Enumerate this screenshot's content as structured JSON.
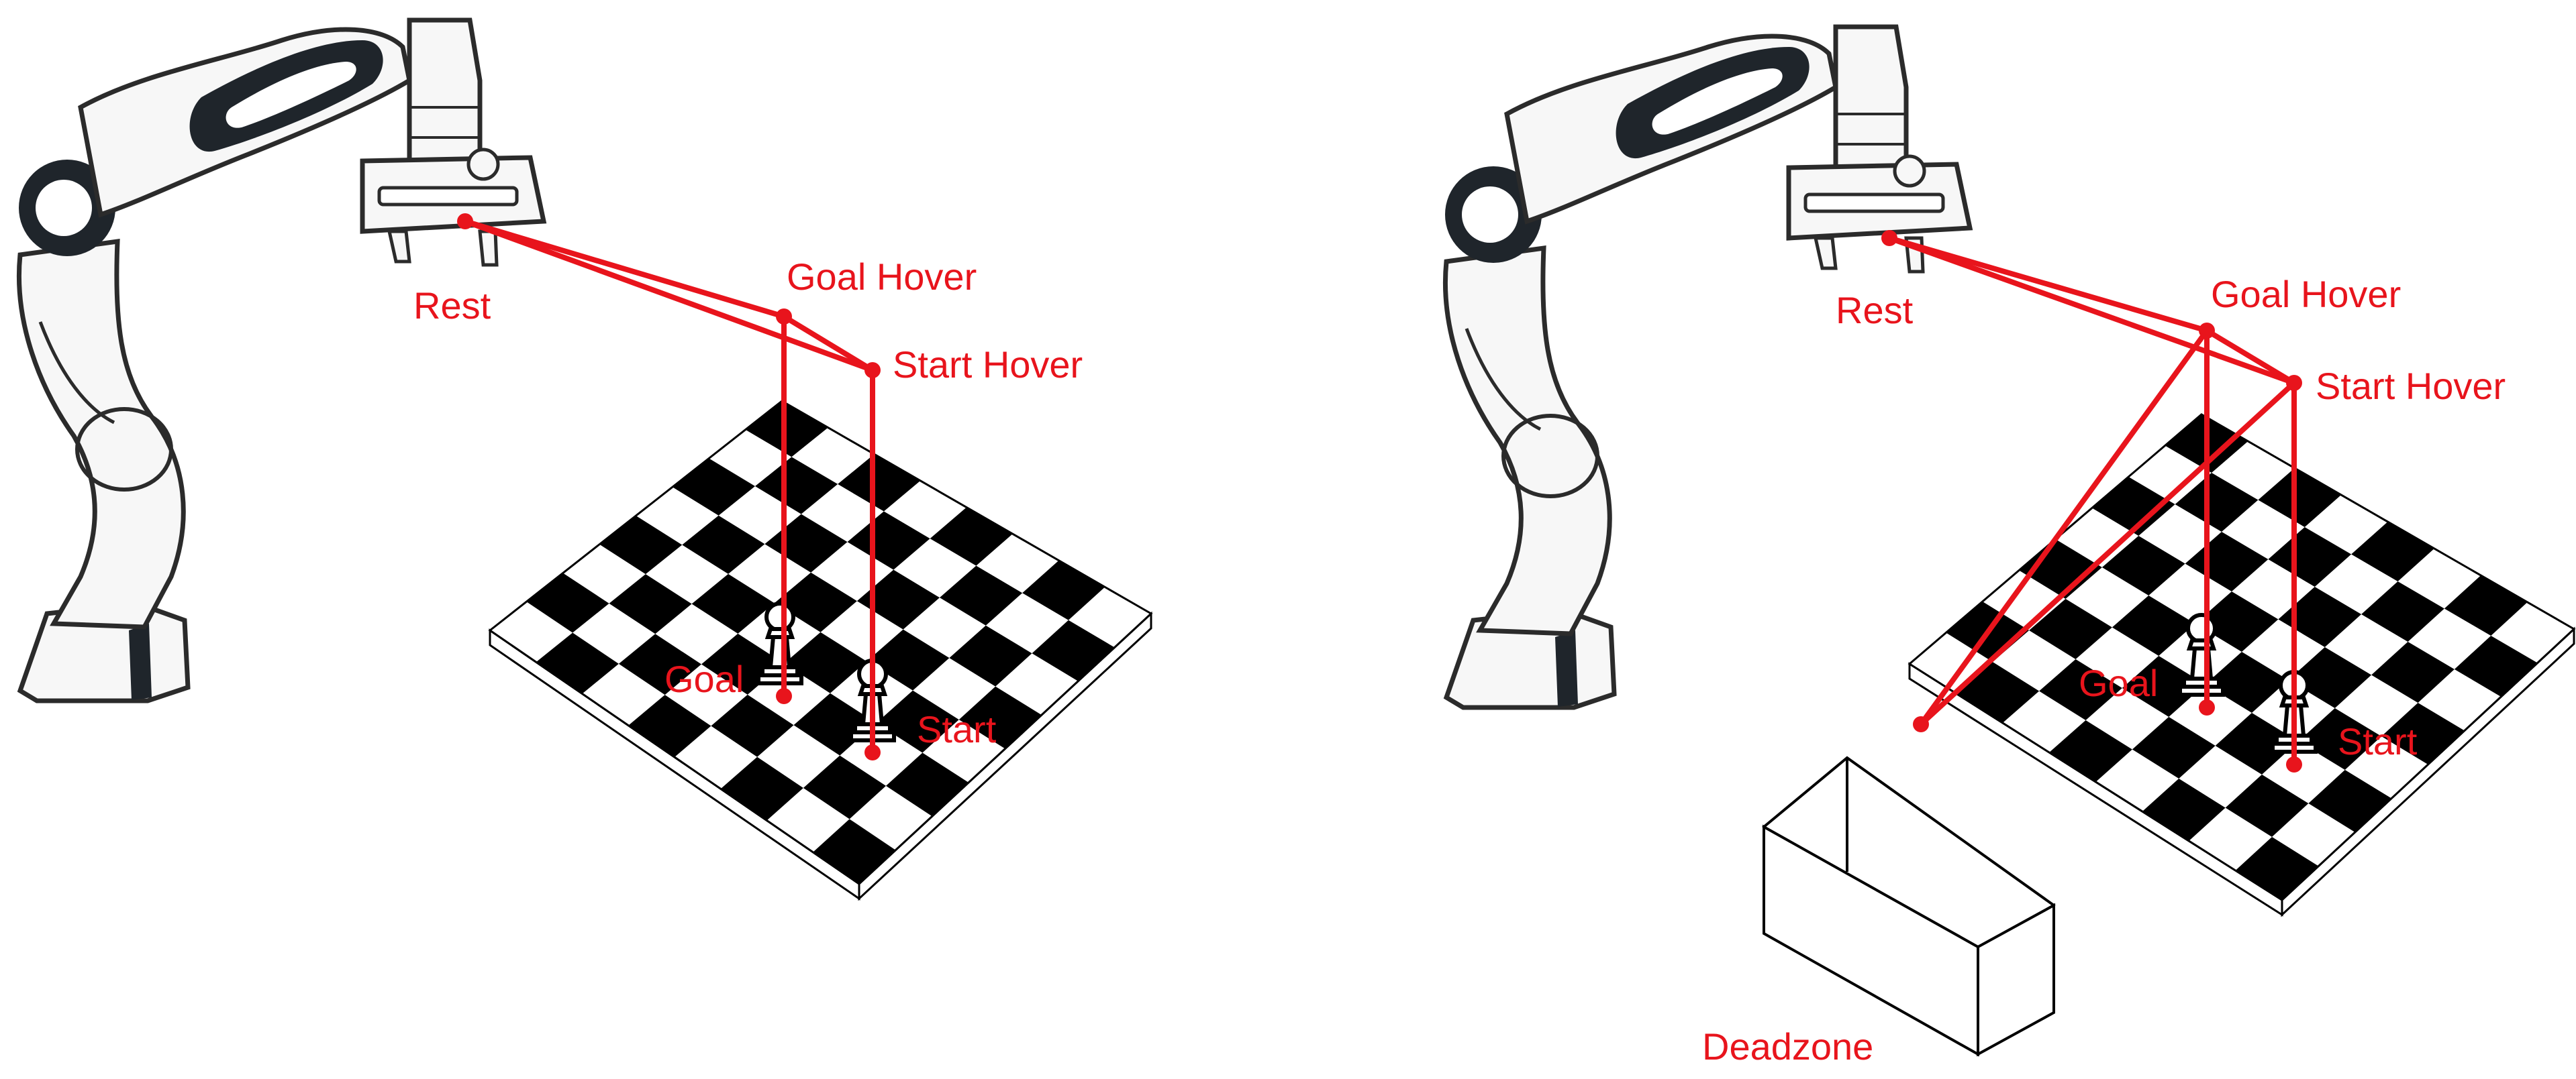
{
  "panels": [
    {
      "id": "left",
      "labels": {
        "rest": "Rest",
        "goal_hover": "Goal Hover",
        "start_hover": "Start Hover",
        "goal": "Goal",
        "start": "Start"
      }
    },
    {
      "id": "right",
      "labels": {
        "rest": "Rest",
        "goal_hover": "Goal Hover",
        "start_hover": "Start Hover",
        "goal": "Goal",
        "start": "Start",
        "deadzone": "Deadzone"
      }
    }
  ],
  "colors": {
    "path": "#e8141c",
    "board_dark": "#000000",
    "board_light": "#ffffff",
    "robot_fill": "#f7f7f7",
    "robot_outline": "#2b2b2b",
    "robot_dark": "#1f252b"
  },
  "icons": [
    "robot-arm",
    "chessboard",
    "pawn-piece",
    "deadzone-bin"
  ]
}
